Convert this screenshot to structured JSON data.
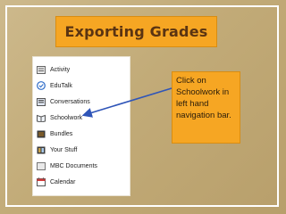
{
  "slide": {
    "title": "Exporting Grades",
    "callout": "Click on Schoolwork in left hand navigation bar."
  },
  "nav": {
    "items": [
      {
        "label": "Activity",
        "icon": "activity-icon"
      },
      {
        "label": "EduTalk",
        "icon": "edutalk-icon"
      },
      {
        "label": "Conversations",
        "icon": "conversations-icon"
      },
      {
        "label": "Schoolwork",
        "icon": "schoolwork-icon"
      },
      {
        "label": "Bundles",
        "icon": "bundles-icon"
      },
      {
        "label": "Your Stuff",
        "icon": "your-stuff-icon"
      },
      {
        "label": "MBC Documents",
        "icon": "documents-icon"
      },
      {
        "label": "Calendar",
        "icon": "calendar-icon"
      }
    ]
  },
  "colors": {
    "background": "#c2ab78",
    "accent": "#f6a623",
    "title_text": "#5a3412",
    "arrow": "#2f55b8"
  }
}
